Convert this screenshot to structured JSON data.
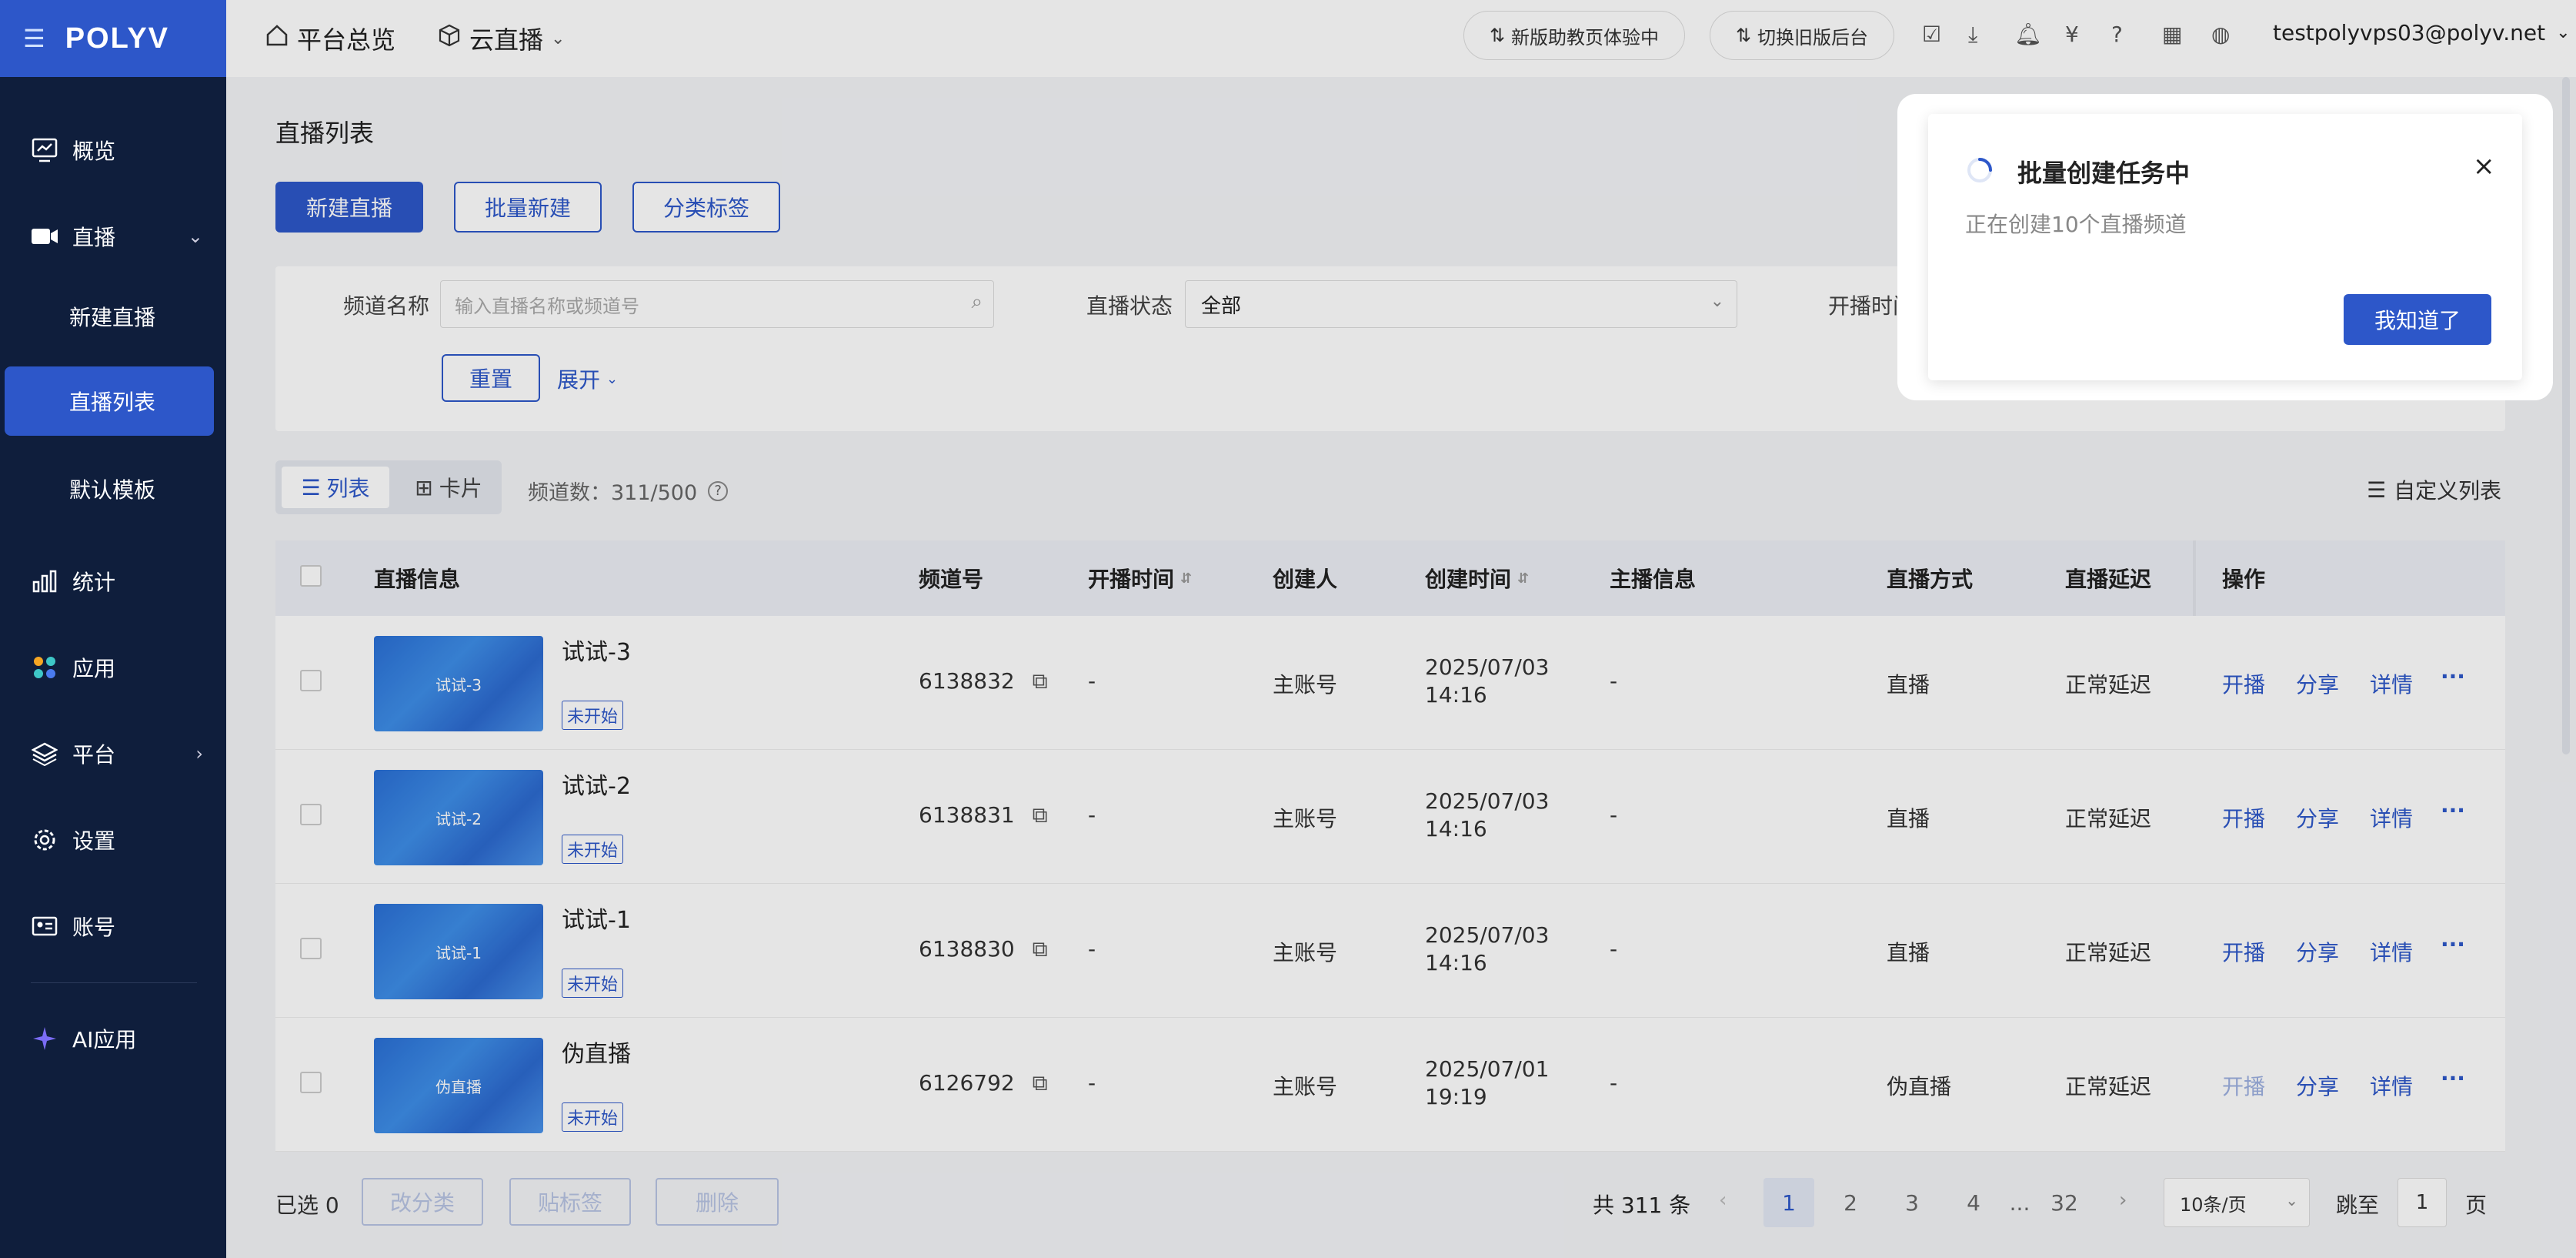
{
  "brand": {
    "logo": "POLYV"
  },
  "sidebar": {
    "overview": "概览",
    "live": "直播",
    "sub": [
      "新建直播",
      "直播列表",
      "默认模板"
    ],
    "stats": "统计",
    "apps": "应用",
    "platform": "平台",
    "settings": "设置",
    "account": "账号",
    "ai": "AI应用"
  },
  "topbar": {
    "home": "平台总览",
    "cloud": "云直播",
    "assistant": "新版助教页体验中",
    "switch_old": "切换旧版后台",
    "user": "testpolyvps03@polyv.net"
  },
  "page": {
    "title": "直播列表",
    "btn_new": "新建直播",
    "btn_batch": "批量新建",
    "btn_tag": "分类标签"
  },
  "filters": {
    "channel_label": "频道名称",
    "channel_placeholder": "输入直播名称或频道号",
    "status_label": "直播状态",
    "status_value": "全部",
    "time_label": "开播时间",
    "reset": "重置",
    "expand": "展开"
  },
  "view": {
    "list": "列表",
    "card": "卡片",
    "count": "频道数：311/500",
    "custom": "自定义列表"
  },
  "table": {
    "headers": [
      "直播信息",
      "频道号",
      "开播时间",
      "创建人",
      "创建时间",
      "主播信息",
      "直播方式",
      "直播延迟",
      "操作"
    ],
    "rows": [
      {
        "thumb": "试试-3",
        "name": "试试-3",
        "status": "未开始",
        "channel": "6138832",
        "start": "-",
        "creator": "主账号",
        "created_date": "2025/07/03",
        "created_time": "14:16",
        "host": "-",
        "mode": "直播",
        "delay": "正常延迟"
      },
      {
        "thumb": "试试-2",
        "name": "试试-2",
        "status": "未开始",
        "channel": "6138831",
        "start": "-",
        "creator": "主账号",
        "created_date": "2025/07/03",
        "created_time": "14:16",
        "host": "-",
        "mode": "直播",
        "delay": "正常延迟"
      },
      {
        "thumb": "试试-1",
        "name": "试试-1",
        "status": "未开始",
        "channel": "6138830",
        "start": "-",
        "creator": "主账号",
        "created_date": "2025/07/03",
        "created_time": "14:16",
        "host": "-",
        "mode": "直播",
        "delay": "正常延迟"
      },
      {
        "thumb": "伪直播",
        "name": "伪直播",
        "status": "未开始",
        "channel": "6126792",
        "start": "-",
        "creator": "主账号",
        "created_date": "2025/07/01",
        "created_time": "19:19",
        "host": "-",
        "mode": "伪直播",
        "delay": "正常延迟"
      }
    ],
    "ops": [
      "开播",
      "分享",
      "详情",
      "···"
    ]
  },
  "footer": {
    "selected": "已选 0",
    "move": "改分类",
    "tag": "贴标签",
    "delete": "删除",
    "total": "共 311 条",
    "pages": [
      "1",
      "2",
      "3",
      "4",
      "...",
      "32"
    ],
    "per_page": "10条/页",
    "goto": "跳至",
    "goto_value": "1",
    "page_unit": "页"
  },
  "dialog": {
    "title": "批量创建任务中",
    "message": "正在创建10个直播频道",
    "ok": "我知道了",
    "close": "×"
  }
}
